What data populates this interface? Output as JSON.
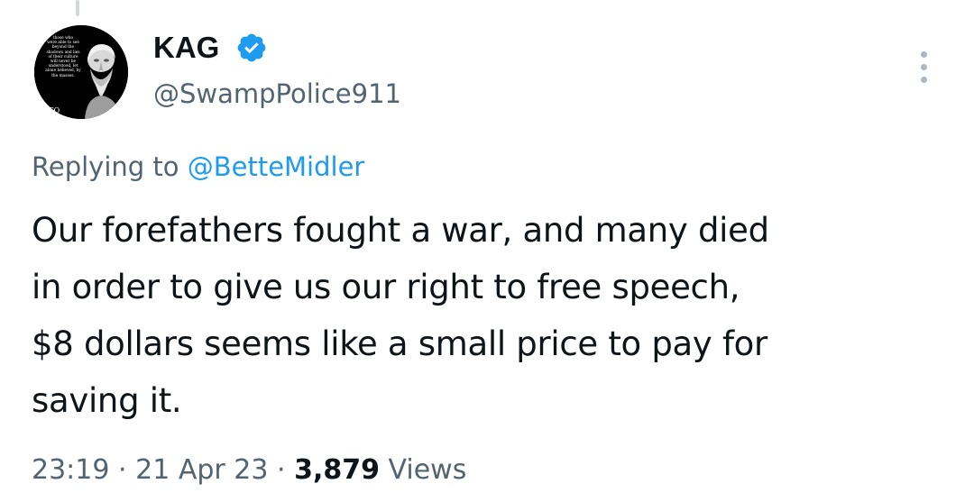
{
  "tweet": {
    "display_name": "KAG",
    "verified": true,
    "handle": "@SwampPolice911",
    "replying_prefix": "Replying to",
    "reply_to": "@BetteMidler",
    "text_lines": [
      "Our forefathers fought a war, and many died",
      "in order to give us our right to free speech,",
      "$8 dollars seems like a small price to pay for",
      "saving it."
    ],
    "time": "23:19",
    "separator": "·",
    "date": "21 Apr 23",
    "views_count": "3,879",
    "views_label": "Views"
  },
  "avatar": {
    "quote_lines": [
      "those who",
      "were able to see",
      "beyond the",
      "shadows and lies",
      "of their culture",
      "will never be",
      "understood, let",
      "alone believed, by",
      "the masses."
    ],
    "signature": "ATO",
    "icon": "plato-bust-avatar"
  },
  "icons": {
    "verified": "verified-badge-icon",
    "more": "more-options-icon"
  },
  "colors": {
    "text": "#0f1419",
    "secondary": "#536471",
    "accent": "#1d9bf0",
    "background": "#ffffff"
  }
}
